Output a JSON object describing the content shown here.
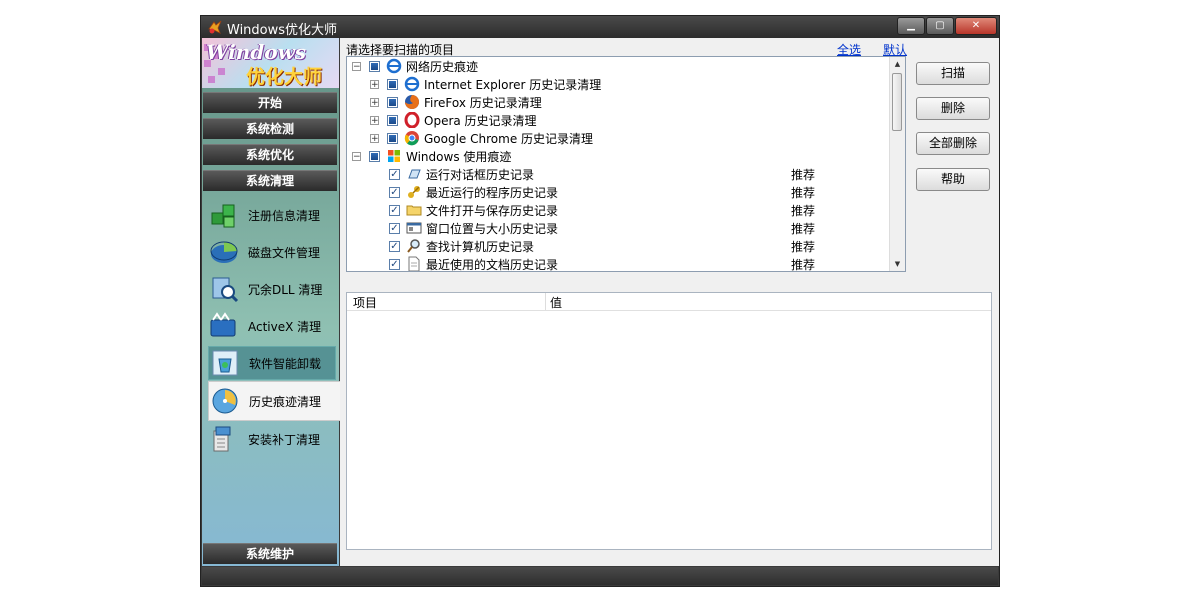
{
  "window": {
    "title": "Windows优化大师"
  },
  "logo": {
    "line1": "Windows",
    "line2": "优化大师"
  },
  "sidebar": {
    "sections": [
      {
        "label": "开始"
      },
      {
        "label": "系统检测"
      },
      {
        "label": "系统优化"
      },
      {
        "label": "系统清理"
      }
    ],
    "items": [
      {
        "label": "注册信息清理",
        "icon": "registry-cubes-icon"
      },
      {
        "label": "磁盘文件管理",
        "icon": "disk-pie-icon"
      },
      {
        "label": "冗余DLL 清理",
        "icon": "dll-magnifier-icon"
      },
      {
        "label": "ActiveX 清理",
        "icon": "activex-film-icon"
      },
      {
        "label": "软件智能卸载",
        "icon": "recycle-bin-icon"
      },
      {
        "label": "历史痕迹清理",
        "icon": "history-globe-icon"
      },
      {
        "label": "安装补丁清理",
        "icon": "installer-box-icon"
      }
    ],
    "footer": "系统维护"
  },
  "main": {
    "prompt": "请选择要扫描的项目",
    "select_all": "全选",
    "default": "默认"
  },
  "tree": {
    "groups": [
      {
        "label": "网络历史痕迹",
        "icon": "ie-icon",
        "children": [
          {
            "label": "Internet Explorer 历史记录清理",
            "icon": "ie-icon"
          },
          {
            "label": "FireFox 历史记录清理",
            "icon": "firefox-icon"
          },
          {
            "label": "Opera 历史记录清理",
            "icon": "opera-icon"
          },
          {
            "label": "Google Chrome 历史记录清理",
            "icon": "chrome-icon"
          }
        ]
      },
      {
        "label": "Windows 使用痕迹",
        "icon": "windows-flag-icon",
        "children": [
          {
            "label": "运行对话框历史记录",
            "rec": "推荐",
            "icon": "run-dialog-icon"
          },
          {
            "label": "最近运行的程序历史记录",
            "rec": "推荐",
            "icon": "keys-icon"
          },
          {
            "label": "文件打开与保存历史记录",
            "rec": "推荐",
            "icon": "folder-icon"
          },
          {
            "label": "窗口位置与大小历史记录",
            "rec": "推荐",
            "icon": "window-icon"
          },
          {
            "label": "查找计算机历史记录",
            "rec": "推荐",
            "icon": "search-icon"
          },
          {
            "label": "最近使用的文档历史记录",
            "rec": "推荐",
            "icon": "document-icon"
          }
        ]
      }
    ]
  },
  "buttons": {
    "scan": "扫描",
    "delete": "删除",
    "delete_all": "全部删除",
    "help": "帮助"
  },
  "table": {
    "columns": [
      "项目",
      "值"
    ]
  }
}
